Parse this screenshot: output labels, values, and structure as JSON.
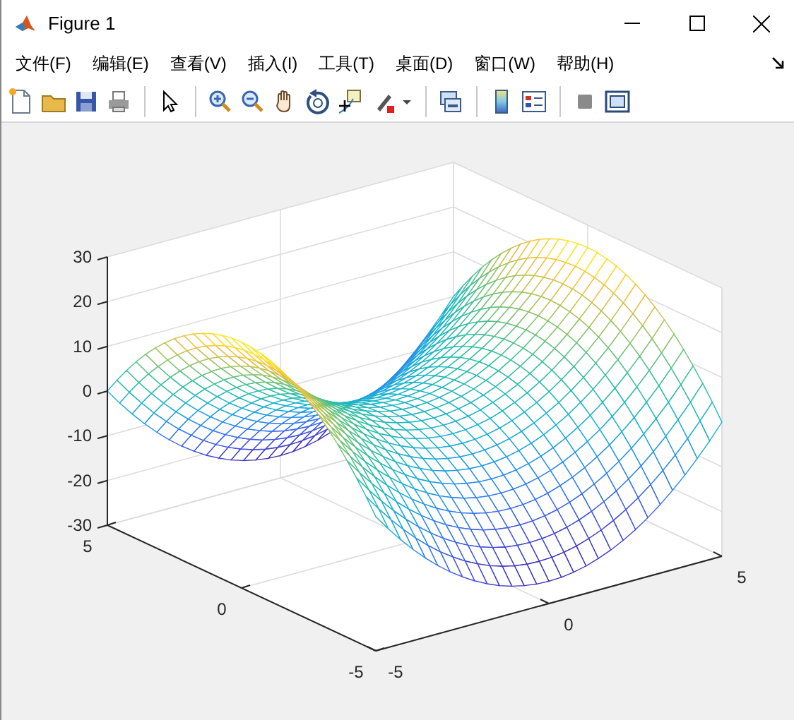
{
  "window": {
    "title": "Figure 1"
  },
  "menu": [
    "文件(F)",
    "编辑(E)",
    "查看(V)",
    "插入(I)",
    "工具(T)",
    "桌面(D)",
    "窗口(W)",
    "帮助(H)"
  ],
  "toolbar": [
    {
      "kind": "new"
    },
    {
      "kind": "open"
    },
    {
      "kind": "save"
    },
    {
      "kind": "print"
    },
    {
      "kind": "separator"
    },
    {
      "kind": "pointer"
    },
    {
      "kind": "separator"
    },
    {
      "kind": "zoom-in"
    },
    {
      "kind": "zoom-out"
    },
    {
      "kind": "pan"
    },
    {
      "kind": "rotate"
    },
    {
      "kind": "data-cursor"
    },
    {
      "kind": "brush"
    },
    {
      "kind": "separator"
    },
    {
      "kind": "link"
    },
    {
      "kind": "separator"
    },
    {
      "kind": "colorbar"
    },
    {
      "kind": "legend"
    },
    {
      "kind": "separator"
    },
    {
      "kind": "hide-tools"
    },
    {
      "kind": "show-tools"
    }
  ],
  "plot": {
    "z_ticks": [
      "30",
      "20",
      "10",
      "0",
      "-10",
      "-20",
      "-30"
    ],
    "left_ticks": [
      "-5",
      "0",
      "5"
    ],
    "right_ticks": [
      "-5",
      "0",
      "5"
    ]
  }
}
